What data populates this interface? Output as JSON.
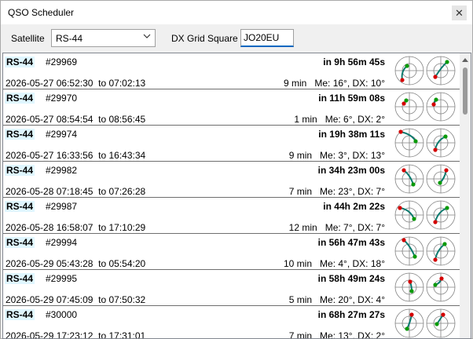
{
  "window": {
    "title": "QSO Scheduler",
    "close_glyph": "✕"
  },
  "toolbar": {
    "satellite_label": "Satellite",
    "satellite_value": "RS-44",
    "grid_label": "DX Grid Square",
    "grid_value": "JO20EU"
  },
  "colors": {
    "track": "#0c7a6e",
    "aos": "#d40000",
    "los": "#0a9a0a",
    "grid": "#808080"
  },
  "passes": [
    {
      "sat": "RS-44",
      "id": "#29969",
      "countdown": "in 9h 56m 45s",
      "date": "2026-05-27",
      "start": "06:52:30",
      "end": "07:02:13",
      "duration": "9 min",
      "elev": "Me: 16°, DX: 10°"
    },
    {
      "sat": "RS-44",
      "id": "#29970",
      "countdown": "in 11h 59m 08s",
      "date": "2026-05-27",
      "start": "08:54:54",
      "end": "08:56:45",
      "duration": "1 min",
      "elev": "Me: 6°, DX: 2°"
    },
    {
      "sat": "RS-44",
      "id": "#29974",
      "countdown": "in 19h 38m 11s",
      "date": "2026-05-27",
      "start": "16:33:56",
      "end": "16:43:34",
      "duration": "9 min",
      "elev": "Me: 3°, DX: 13°"
    },
    {
      "sat": "RS-44",
      "id": "#29982",
      "countdown": "in 34h 23m 00s",
      "date": "2026-05-28",
      "start": "07:18:45",
      "end": "07:26:28",
      "duration": "7 min",
      "elev": "Me: 23°, DX: 7°"
    },
    {
      "sat": "RS-44",
      "id": "#29987",
      "countdown": "in 44h 2m 22s",
      "date": "2026-05-28",
      "start": "16:58:07",
      "end": "17:10:29",
      "duration": "12 min",
      "elev": "Me: 7°, DX: 7°"
    },
    {
      "sat": "RS-44",
      "id": "#29994",
      "countdown": "in 56h 47m 43s",
      "date": "2026-05-29",
      "start": "05:43:28",
      "end": "05:54:20",
      "duration": "10 min",
      "elev": "Me: 4°, DX: 18°"
    },
    {
      "sat": "RS-44",
      "id": "#29995",
      "countdown": "in 58h 49m 24s",
      "date": "2026-05-29",
      "start": "07:45:09",
      "end": "07:50:32",
      "duration": "5 min",
      "elev": "Me: 20°, DX: 4°"
    },
    {
      "sat": "RS-44",
      "id": "#30000",
      "countdown": "in 68h 27m 27s",
      "date": "2026-05-29",
      "start": "17:23:12",
      "end": "17:31:01",
      "duration": "7 min",
      "elev": "Me: 13°, DX: 2°"
    }
  ]
}
